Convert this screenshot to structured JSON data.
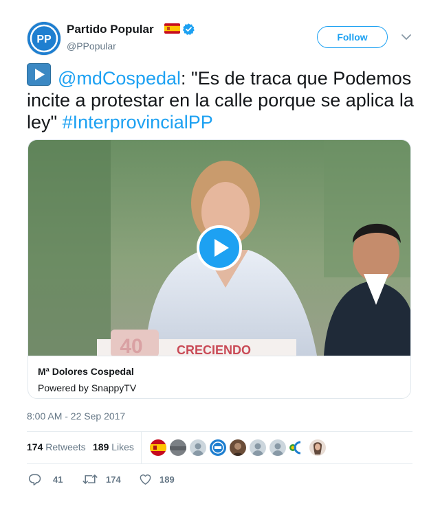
{
  "header": {
    "display_name": "Partido Popular",
    "handle": "@PPopular",
    "avatar_text": "PP",
    "follow_label": "Follow"
  },
  "tweet": {
    "mention": "@mdCospedal",
    "text_body": ": \"Es de traca que Podemos incite a protestar en la calle porque se aplica la ley\" ",
    "hashtag": "#InterprovincialPP"
  },
  "card": {
    "title": "Mª Dolores Cospedal",
    "subtitle": "Powered by SnappyTV",
    "video_banner_text": "CRECIENDO",
    "video_logo_text": "40"
  },
  "timestamp": "8:00 AM - 22 Sep 2017",
  "stats": {
    "retweets_count": "174",
    "retweets_label": "Retweets",
    "likes_count": "189",
    "likes_label": "Likes"
  },
  "actions": {
    "replies": "41",
    "retweets": "174",
    "likes": "189"
  },
  "colors": {
    "accent": "#1da1f2",
    "text": "#14171a",
    "muted": "#657786",
    "border": "#e1e8ed",
    "brand_blue": "#1f7fd0"
  },
  "icons": [
    "pp-logo-icon",
    "spain-flag-icon",
    "verified-badge-icon",
    "chevron-down-icon",
    "play-button-emoji-icon",
    "video-play-icon",
    "reply-icon",
    "retweet-icon",
    "like-heart-icon"
  ]
}
